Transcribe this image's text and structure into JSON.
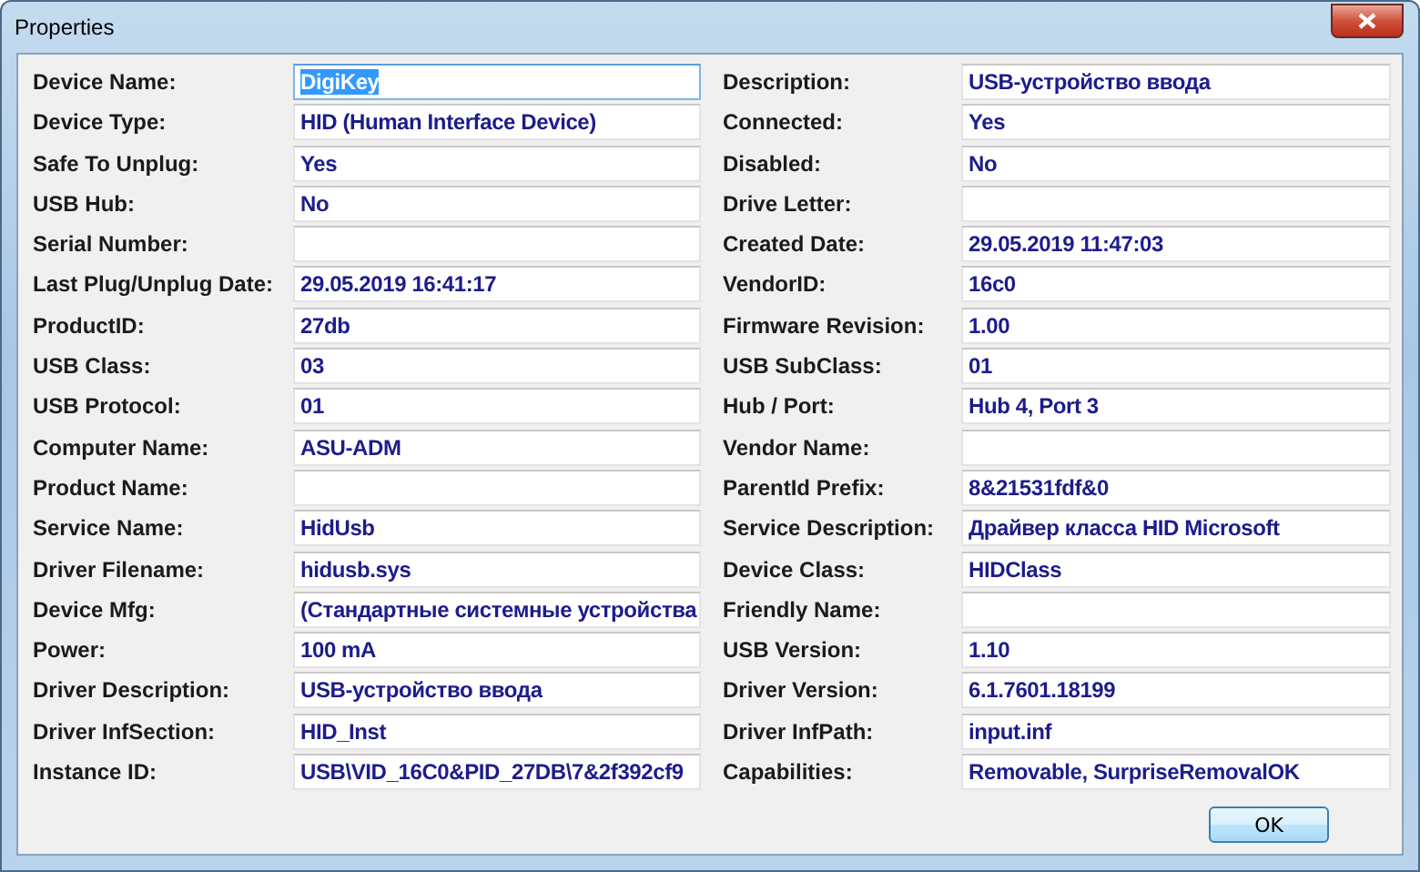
{
  "window": {
    "title": "Properties"
  },
  "left_fields": [
    {
      "label": "Device Name:",
      "value": "DigiKey",
      "selected": true
    },
    {
      "label": "Device Type:",
      "value": "HID (Human Interface Device)",
      "selected": false
    },
    {
      "label": "Safe To Unplug:",
      "value": "Yes",
      "selected": false
    },
    {
      "label": "USB Hub:",
      "value": "No",
      "selected": false
    },
    {
      "label": "Serial Number:",
      "selected": false
    },
    {
      "label": "Last Plug/Unplug Date:",
      "value": "29.05.2019 16:41:17",
      "selected": false
    },
    {
      "label": "ProductID:",
      "value": "27db",
      "selected": false
    },
    {
      "label": "USB Class:",
      "value": "03",
      "selected": false
    },
    {
      "label": "USB Protocol:",
      "value": "01",
      "selected": false
    },
    {
      "label": "Computer Name:",
      "value": "ASU-ADM",
      "selected": false
    },
    {
      "label": "Product Name:",
      "selected": false
    },
    {
      "label": "Service Name:",
      "value": "HidUsb",
      "selected": false
    },
    {
      "label": "Driver Filename:",
      "value": "hidusb.sys",
      "selected": false
    },
    {
      "label": "Device Mfg:",
      "value": "(Стандартные системные устройства",
      "selected": false
    },
    {
      "label": "Power:",
      "value": "100 mA",
      "selected": false
    },
    {
      "label": "Driver Description:",
      "value": "USB-устройство ввода",
      "selected": false
    },
    {
      "label": "Driver InfSection:",
      "value": "HID_Inst",
      "selected": false
    },
    {
      "label": "Instance ID:",
      "value": "USB\\VID_16C0&PID_27DB\\7&2f392cf9",
      "selected": false
    }
  ],
  "right_fields": [
    {
      "label": "Description:",
      "value": "USB-устройство ввода",
      "selected": false
    },
    {
      "label": "Connected:",
      "value": "Yes",
      "selected": false
    },
    {
      "label": "Disabled:",
      "value": "No",
      "selected": false
    },
    {
      "label": "Drive Letter:",
      "selected": false
    },
    {
      "label": "Created Date:",
      "value": "29.05.2019 11:47:03",
      "selected": false
    },
    {
      "label": "VendorID:",
      "value": "16c0",
      "selected": false
    },
    {
      "label": "Firmware Revision:",
      "value": "1.00",
      "selected": false
    },
    {
      "label": "USB SubClass:",
      "value": "01",
      "selected": false
    },
    {
      "label": "Hub / Port:",
      "value": "Hub 4, Port 3",
      "selected": false
    },
    {
      "label": "Vendor Name:",
      "selected": false
    },
    {
      "label": "ParentId Prefix:",
      "value": "8&21531fdf&0",
      "selected": false
    },
    {
      "label": "Service Description:",
      "value": "Драйвер класса HID Microsoft",
      "selected": false
    },
    {
      "label": "Device Class:",
      "value": "HIDClass",
      "selected": false
    },
    {
      "label": "Friendly Name:",
      "selected": false
    },
    {
      "label": "USB Version:",
      "value": "1.10",
      "selected": false
    },
    {
      "label": "Driver Version:",
      "value": "6.1.7601.18199",
      "selected": false
    },
    {
      "label": "Driver InfPath:",
      "value": "input.inf",
      "selected": false
    },
    {
      "label": "Capabilities:",
      "value": "Removable, SurpriseRemovalOK",
      "selected": false
    }
  ],
  "buttons": [
    {
      "label": "OK"
    }
  ]
}
